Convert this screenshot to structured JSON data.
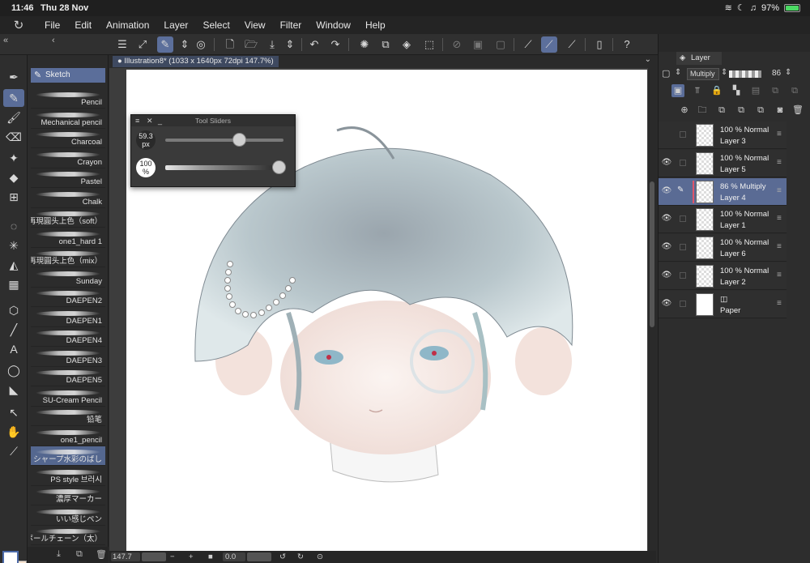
{
  "status_bar": {
    "time": "11:46",
    "date": "Thu 28 Nov",
    "battery": "97%",
    "battery_level": 0.97
  },
  "menu": [
    "File",
    "Edit",
    "Animation",
    "Layer",
    "Select",
    "View",
    "Filter",
    "Window",
    "Help"
  ],
  "sub_tool": {
    "group": "Sketch",
    "brushes": [
      "Pencil",
      "Mechanical pencil",
      "Charcoal",
      "Crayon",
      "Pastel",
      "Chalk",
      "再現圓头上色（soft）",
      "one1_hard 1",
      "再現圓头上色（mix）",
      "Sunday",
      "DAEPEN2",
      "DAEPEN1",
      "DAEPEN4",
      "DAEPEN3",
      "DAEPEN5",
      "SU-Cream Pencil",
      "铅笔",
      "one1_pencil",
      "シャープ水彩のばし",
      "PS style 브러시",
      "濃厚マーカー",
      "いい感じペン",
      "ボールチェーン（太）"
    ],
    "selected_index": 18
  },
  "canvas": {
    "tab_title": "Illustration8* (1033 x 1640px 72dpi 147.7%)",
    "zoom": "147.7",
    "angle": "0.0"
  },
  "tool_sliders": {
    "title": "Tool Sliders",
    "size_value": "59.3",
    "size_unit": "px",
    "size_level": 0.62,
    "opacity_value": "100",
    "opacity_unit": "%",
    "opacity_level": 1.0
  },
  "layer_panel": {
    "title": "Layer",
    "blend_mode": "Multiply",
    "opacity": "86",
    "layers": [
      {
        "opacity": "100 %",
        "mode": "Normal",
        "name": "Layer 3",
        "visible": false
      },
      {
        "opacity": "100 %",
        "mode": "Normal",
        "name": "Layer 5",
        "visible": true
      },
      {
        "opacity": "86 %",
        "mode": "Multiply",
        "name": "Layer 4",
        "visible": true,
        "selected": true
      },
      {
        "opacity": "100 %",
        "mode": "Normal",
        "name": "Layer 1",
        "visible": true
      },
      {
        "opacity": "100 %",
        "mode": "Normal",
        "name": "Layer 6",
        "visible": true
      },
      {
        "opacity": "100 %",
        "mode": "Normal",
        "name": "Layer 2",
        "visible": true
      },
      {
        "opacity": "",
        "mode": "",
        "name": "Paper",
        "visible": true,
        "paper": true
      }
    ]
  }
}
